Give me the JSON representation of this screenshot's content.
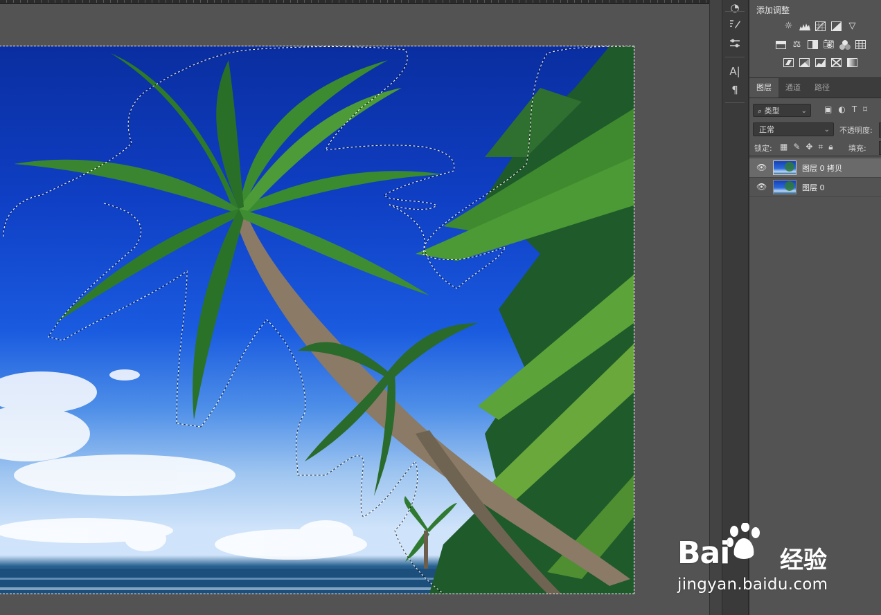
{
  "app": "Photoshop",
  "toolbar_column": {
    "tools": [
      {
        "icon": "brush-settings-icon",
        "glyph": "⚒"
      },
      {
        "icon": "adjustments-sliders-icon",
        "glyph": "≡"
      },
      {
        "icon": "character-icon",
        "glyph": "A|"
      },
      {
        "icon": "paragraph-icon",
        "glyph": "¶"
      }
    ]
  },
  "adjustments": {
    "title": "添加调整",
    "row1": [
      "brightness-icon",
      "levels-icon",
      "curves-icon",
      "exposure-icon",
      "vibrance-icon"
    ],
    "row2": [
      "hue-saturation-icon",
      "color-balance-icon",
      "black-white-icon",
      "photo-filter-icon",
      "channel-mixer-icon",
      "color-lookup-icon"
    ],
    "row3": [
      "invert-icon",
      "posterize-icon",
      "threshold-icon",
      "selective-color-icon",
      "gradient-map-icon"
    ]
  },
  "layers_panel": {
    "tabs": [
      {
        "label": "图层",
        "active": true
      },
      {
        "label": "通道",
        "active": false
      },
      {
        "label": "路径",
        "active": false
      }
    ],
    "filter_kind": "⌕ 类型",
    "blend_mode": "正常",
    "opacity_label": "不透明度:",
    "lock_label": "锁定:",
    "fill_label": "填充:",
    "layers": [
      {
        "name": "图层 0 拷贝",
        "visible": true,
        "selected": true
      },
      {
        "name": "图层 0",
        "visible": true,
        "selected": false
      }
    ]
  },
  "watermark": {
    "brand": "Bai",
    "brand_suffix": "经验",
    "url": "jingyan.baidu.com"
  }
}
